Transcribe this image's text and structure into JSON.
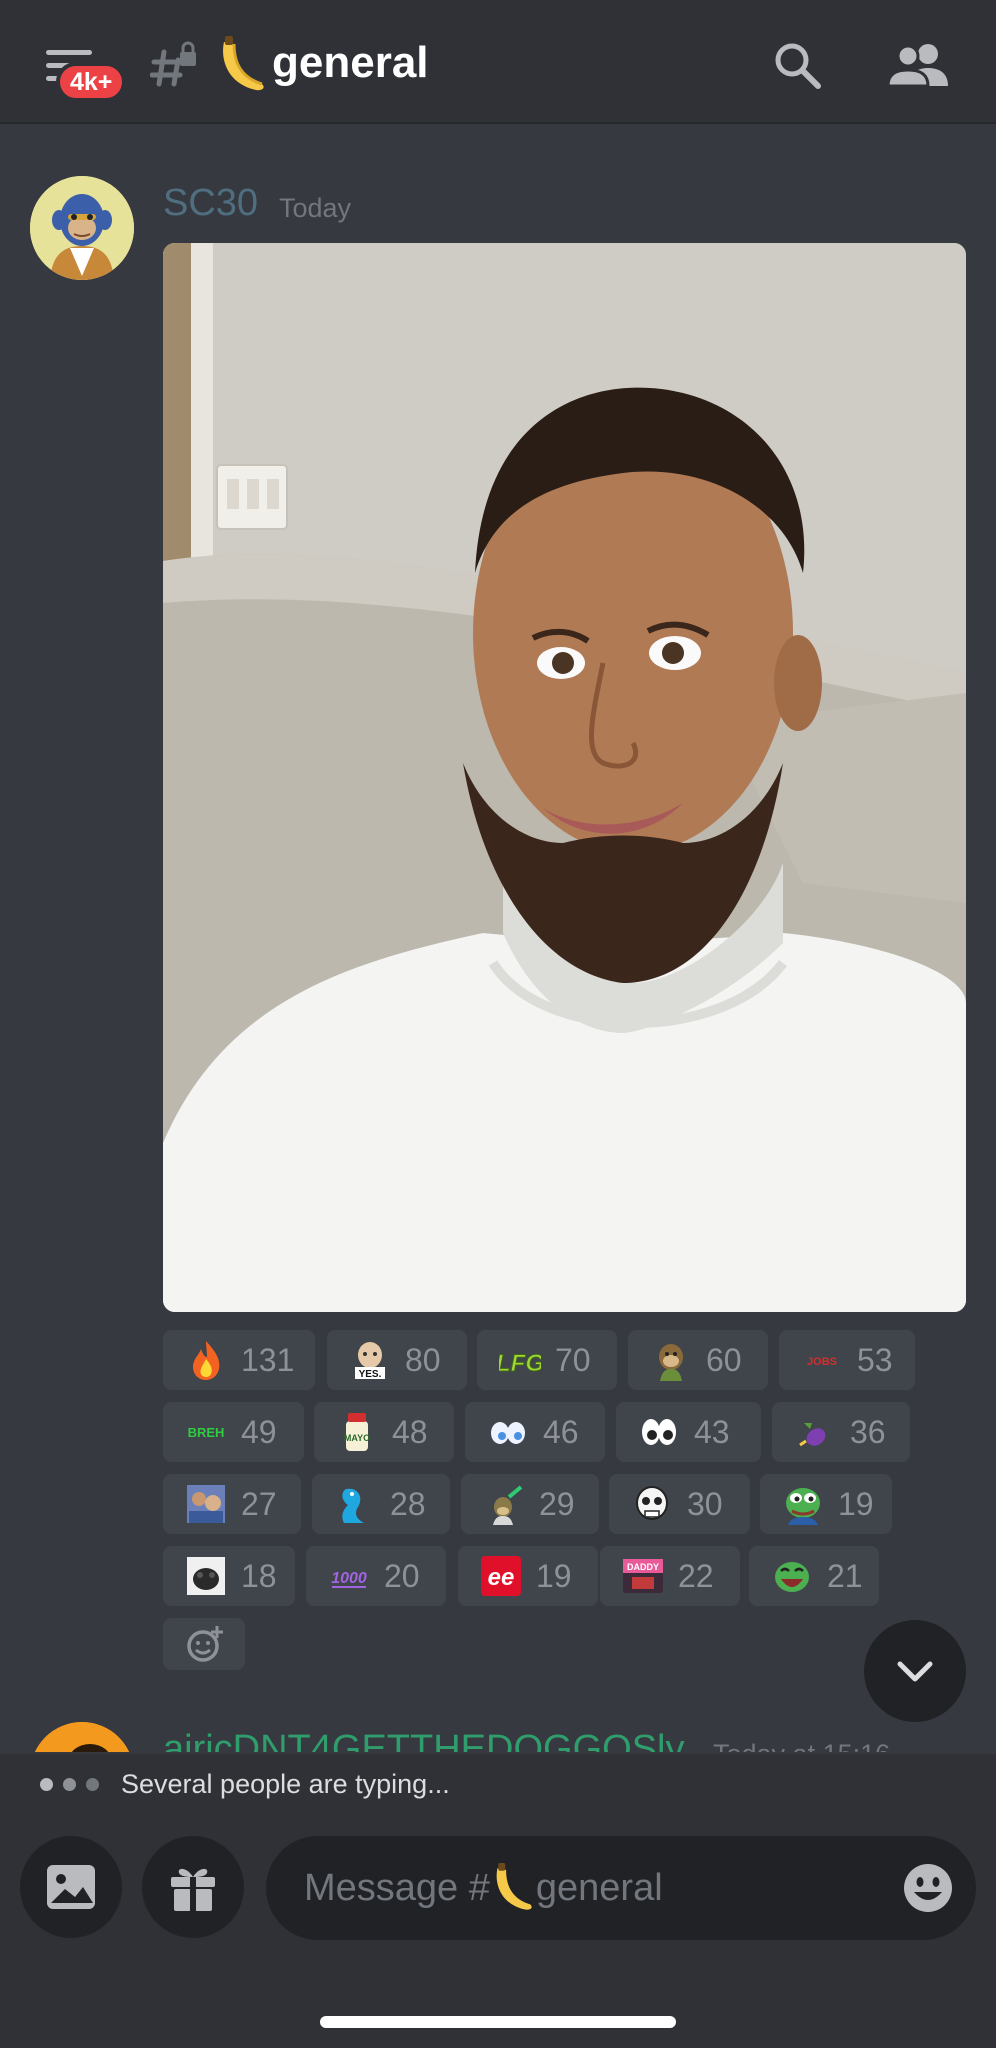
{
  "header": {
    "unread_badge": "4k+",
    "channel_name": "general",
    "channel_emoji": "banana-emoji",
    "icons": [
      "menu-icon",
      "hash-lock-icon",
      "search-icon",
      "members-icon"
    ]
  },
  "message": {
    "author": "SC30",
    "timestamp": "Today",
    "author_color": "#4f6f80",
    "attachment": "photo"
  },
  "reactions": [
    [
      {
        "emoji": "fire-emoji",
        "count": "131"
      },
      {
        "emoji": "yes-sticker-emoji",
        "count": "80"
      },
      {
        "emoji": "lfg-emoji",
        "count": "70"
      },
      {
        "emoji": "ape-emoji",
        "count": "60"
      },
      {
        "emoji": "jobs-emoji",
        "count": "53"
      }
    ],
    [
      {
        "emoji": "breh-emoji",
        "count": "49"
      },
      {
        "emoji": "mayo-emoji",
        "count": "48"
      },
      {
        "emoji": "eyes-blue-emoji",
        "count": "46"
      },
      {
        "emoji": "eyes-emoji",
        "count": "43"
      },
      {
        "emoji": "eggplant-emoji",
        "count": "36"
      }
    ],
    [
      {
        "emoji": "photo-emoji",
        "count": "27"
      },
      {
        "emoji": "dolphin-emoji",
        "count": "28"
      },
      {
        "emoji": "ape-chef-emoji",
        "count": "29"
      },
      {
        "emoji": "skull-ape-emoji",
        "count": "30"
      },
      {
        "emoji": "pepe-emoji",
        "count": "19"
      }
    ],
    [
      {
        "emoji": "pug-emoji",
        "count": "18"
      },
      {
        "emoji": "1000-emoji",
        "count": "20"
      },
      {
        "emoji": "ee-emoji",
        "count": "19"
      },
      {
        "emoji": "daddy-emoji",
        "count": "22"
      },
      {
        "emoji": "pepe-laugh-emoji",
        "count": "21"
      }
    ]
  ],
  "next_message": {
    "author": "airicDNT4GETTHEDOGGOSly",
    "timestamp": "Today at 15:16"
  },
  "typing": {
    "text": "Several people are typing..."
  },
  "composer": {
    "placeholder_prefix": "Message #",
    "placeholder_channel": "general"
  },
  "colors": {
    "background": "#36393f",
    "header": "#2f3136",
    "badge": "#ed4245",
    "reaction_bg": "#40444b"
  }
}
